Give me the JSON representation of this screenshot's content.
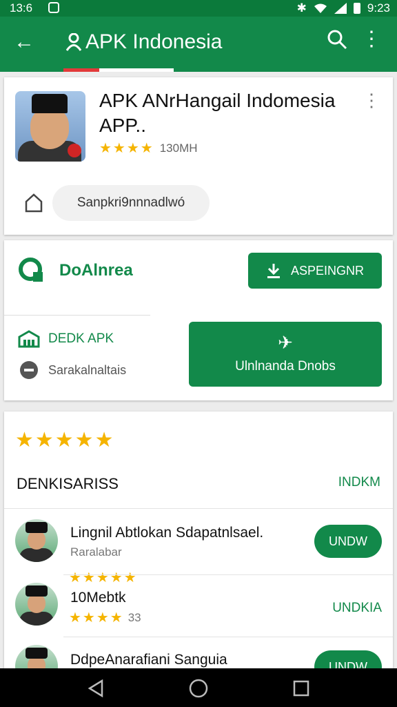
{
  "status": {
    "time": "13:6",
    "time_right": "9:23"
  },
  "appbar": {
    "title": "APK Indonesia"
  },
  "app": {
    "name_line1": "APK ANrHangail Indomesia",
    "name_line2": "APP..",
    "rating_stars": 3.5,
    "downloads": "130MH",
    "share_pill": "Sanpkri9nnnadlwó"
  },
  "download_card": {
    "brand": "DoAlnrea",
    "top_button": "ASPEINGNR",
    "left_label": "DEDK APK",
    "left_sub": "Sarakalnaltais",
    "big_button": "Ulnlnanda Dnobs"
  },
  "reviews": {
    "overall_stars": 4.5,
    "section_title": "DENKISARISS",
    "section_action": "INDKM",
    "items": [
      {
        "title": "Lingnil Abtlokan Sdapatnlsael.",
        "subtitle": "Raralabar",
        "stars": 4.5,
        "count": "",
        "action": "UNDW",
        "action_style": "button"
      },
      {
        "title": "10Mebtk",
        "subtitle": "",
        "stars": 4,
        "count": "33",
        "action": "UNDKIA",
        "action_style": "text"
      },
      {
        "title": "DdpeAnarafiani Sanguia",
        "subtitle": "",
        "stars": 0,
        "count": "",
        "action": "UNDW",
        "action_style": "button"
      }
    ]
  },
  "colors": {
    "primary": "#12894a",
    "star": "#f5b400"
  }
}
